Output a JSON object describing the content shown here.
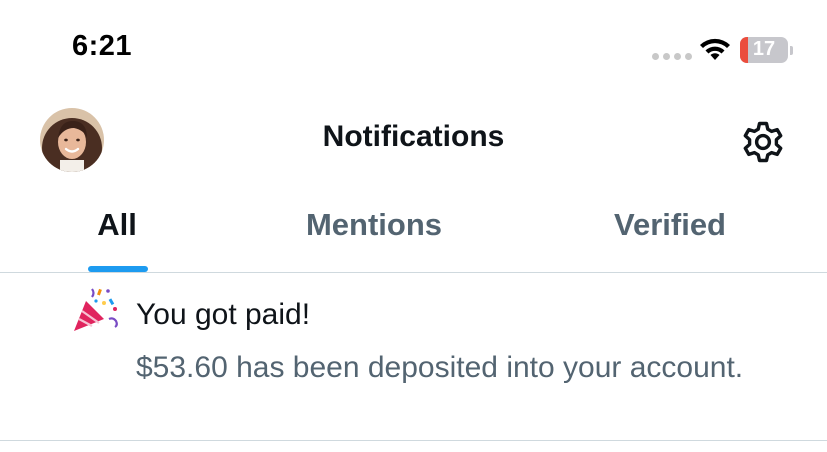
{
  "status_bar": {
    "time": "6:21",
    "battery_percent": "17",
    "battery_level": 0.17,
    "battery_color": "#eb4d3d"
  },
  "header": {
    "title": "Notifications",
    "avatar_icon": "profile-avatar",
    "settings_icon": "gear-icon"
  },
  "tabs": [
    {
      "label": "All",
      "active": true
    },
    {
      "label": "Mentions",
      "active": false
    },
    {
      "label": "Verified",
      "active": false
    }
  ],
  "notifications": [
    {
      "icon": "party-popper-icon",
      "title": "You got paid!",
      "body": "$53.60 has been deposited into your account."
    }
  ],
  "colors": {
    "accent": "#1d9bf0",
    "text_primary": "#0f1419",
    "text_secondary": "#536471",
    "divider": "#cfd9de"
  }
}
